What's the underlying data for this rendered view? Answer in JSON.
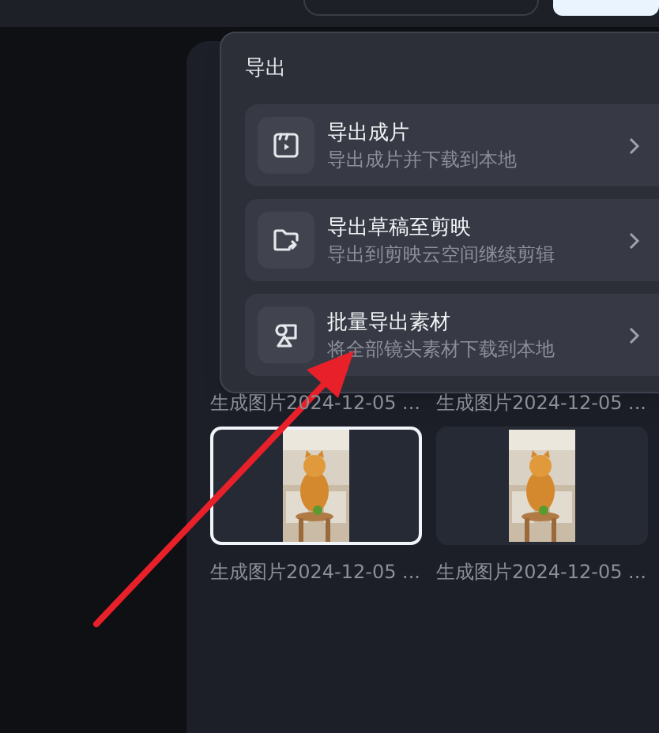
{
  "export_menu": {
    "title": "导出",
    "items": [
      {
        "kind": "video",
        "title": "导出成片",
        "subtitle": "导出成片并下载到本地"
      },
      {
        "kind": "draft",
        "title": "导出草稿至剪映",
        "subtitle": "导出到剪映云空间继续剪辑"
      },
      {
        "kind": "assets",
        "title": "批量导出素材",
        "subtitle": "将全部镜头素材下载到本地"
      }
    ]
  },
  "gallery": {
    "captions_above": [
      "生成图片2024-12-05 ...",
      "生成图片2024-12-05 ..."
    ],
    "items": [
      {
        "kind": "picture",
        "selected": true,
        "caption": "生成图片2024-12-05 ..."
      },
      {
        "kind": "picture",
        "selected": false,
        "caption": "生成图片2024-12-05 ..."
      }
    ]
  }
}
